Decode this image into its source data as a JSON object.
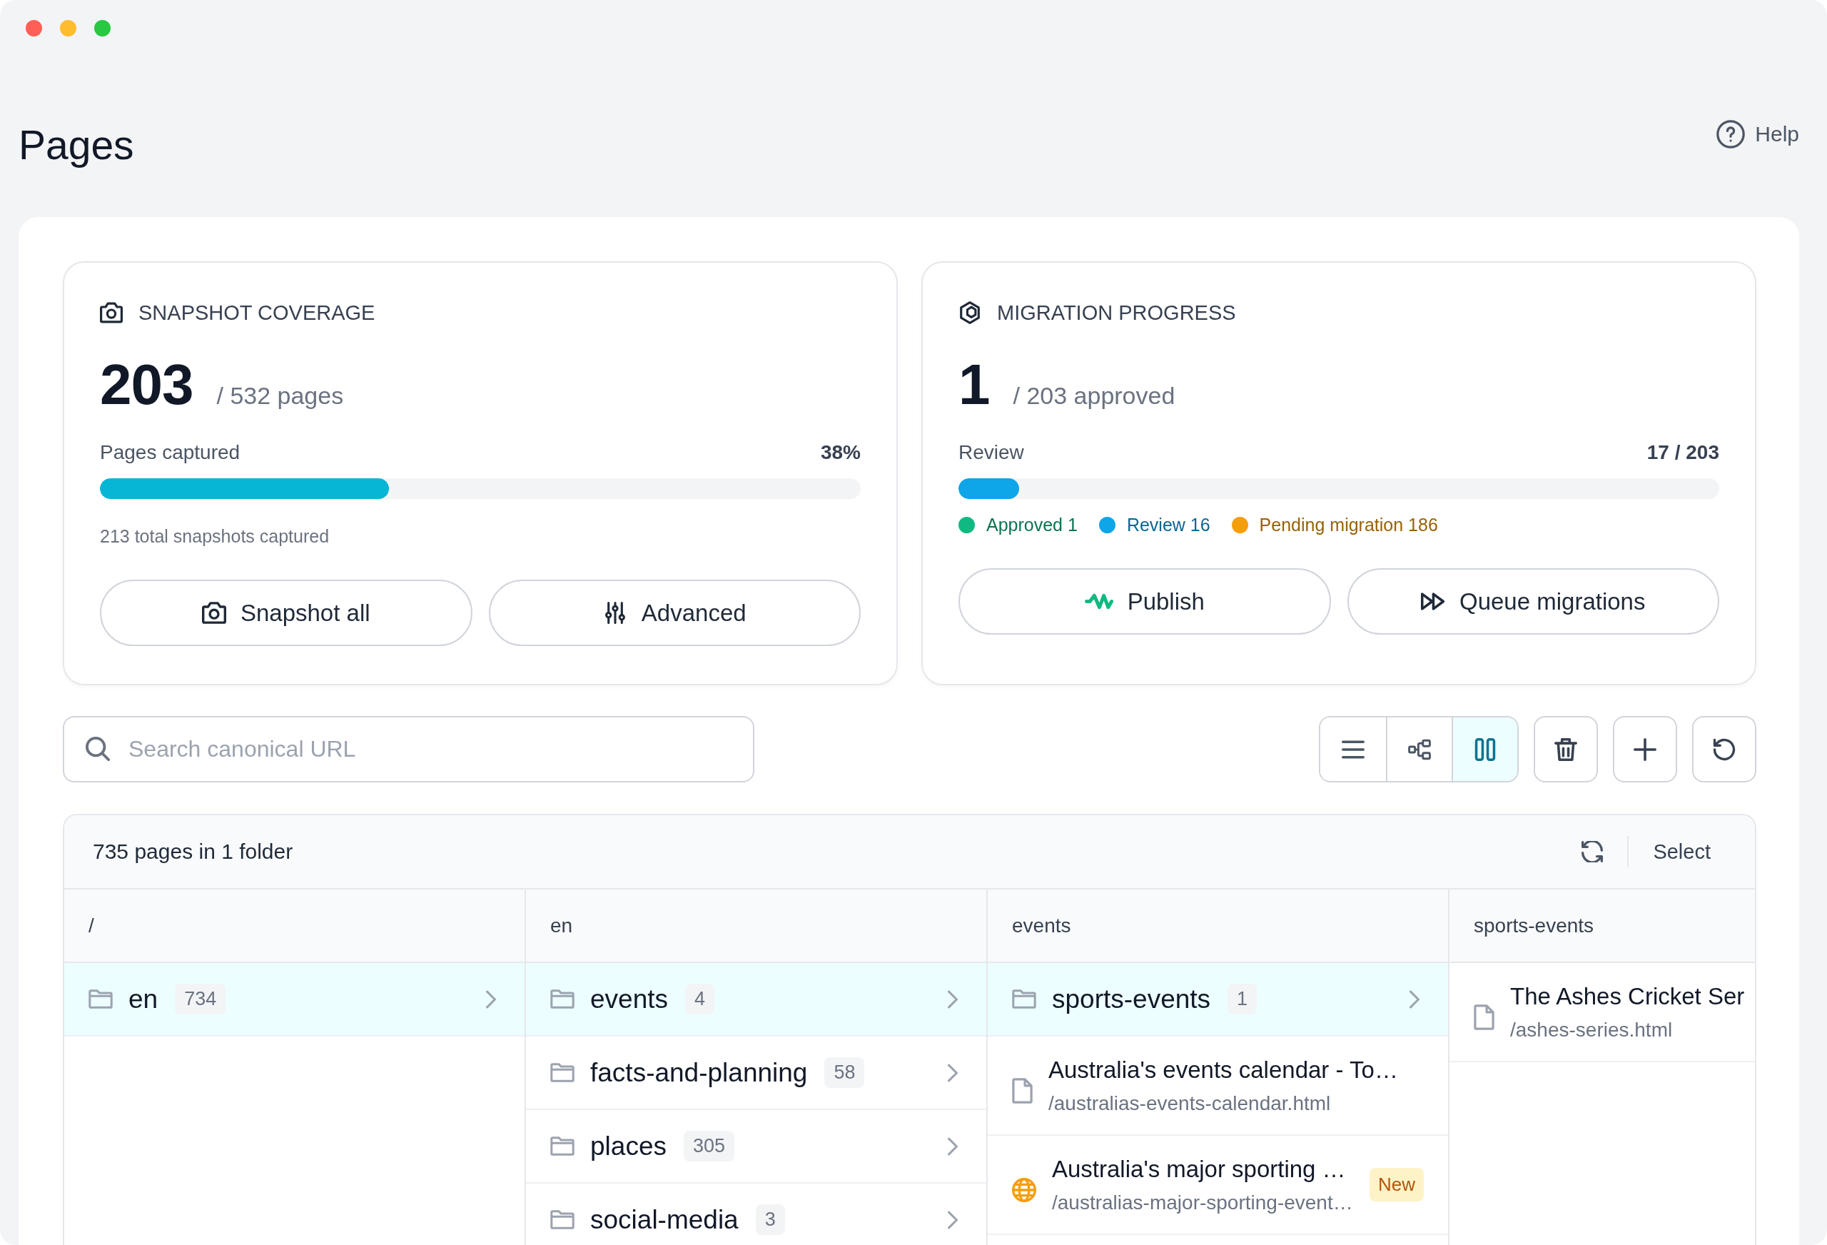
{
  "window": {
    "title": "Pages",
    "help": "Help"
  },
  "cards": [
    {
      "kind": "snapshot",
      "title": "SNAPSHOT COVERAGE",
      "value": "203",
      "total": "/ 532 pages",
      "progress": {
        "label": "Pages captured",
        "reading": "38%",
        "level": 0.38
      },
      "note": "213 total snapshots captured",
      "buttons": [
        {
          "kind": "snapshot",
          "label": "Snapshot all"
        },
        {
          "kind": "settings",
          "label": "Advanced"
        }
      ]
    },
    {
      "kind": "migration",
      "title": "MIGRATION PROGRESS",
      "value": "1",
      "total": "/ 203 approved",
      "progress": {
        "label": "Review",
        "reading": "17 / 203",
        "level": 0.08
      },
      "legend": [
        {
          "label": "Approved 1",
          "color": "#10b981"
        },
        {
          "label": "Review 16",
          "color": "#0ea5e9"
        },
        {
          "label": "Pending migration 186",
          "color": "#f59e0b"
        }
      ],
      "buttons": [
        {
          "kind": "publish",
          "label": "Publish"
        },
        {
          "kind": "queue",
          "label": "Queue migrations"
        }
      ]
    }
  ],
  "search": {
    "placeholder": "Search canonical URL"
  },
  "toolbar": {
    "views": [
      {
        "kind": "list",
        "selected": false
      },
      {
        "kind": "tree",
        "selected": false
      },
      {
        "kind": "columns",
        "selected": true
      }
    ],
    "actions": [
      {
        "kind": "delete"
      },
      {
        "kind": "add"
      },
      {
        "kind": "reset"
      }
    ]
  },
  "browser": {
    "summary": "735 pages in 1 folder",
    "select": "Select",
    "columns": [
      {
        "heading": "/",
        "items": [
          {
            "kind": "folder",
            "name": "en",
            "count": "734",
            "selected": true
          }
        ]
      },
      {
        "heading": "en",
        "items": [
          {
            "kind": "folder",
            "name": "events",
            "count": "4",
            "selected": true
          },
          {
            "kind": "folder",
            "name": "facts-and-planning",
            "count": "58",
            "selected": false
          },
          {
            "kind": "folder",
            "name": "places",
            "count": "305",
            "selected": false
          },
          {
            "kind": "folder",
            "name": "social-media",
            "count": "3",
            "selected": false
          }
        ]
      },
      {
        "heading": "events",
        "items": [
          {
            "kind": "folder",
            "name": "sports-events",
            "count": "1",
            "selected": true
          },
          {
            "kind": "page",
            "title": "Australia's events calendar - To…",
            "path": "/australias-events-calendar.html",
            "selected": false
          },
          {
            "kind": "web",
            "title": "Australia's major sporting …",
            "path": "/australias-major-sporting-event…",
            "badge": "New",
            "selected": false
          }
        ]
      },
      {
        "heading": "sports-events",
        "items": [
          {
            "kind": "page",
            "title": "The Ashes Cricket Ser",
            "path": "/ashes-series.html",
            "selected": false
          }
        ]
      }
    ]
  }
}
